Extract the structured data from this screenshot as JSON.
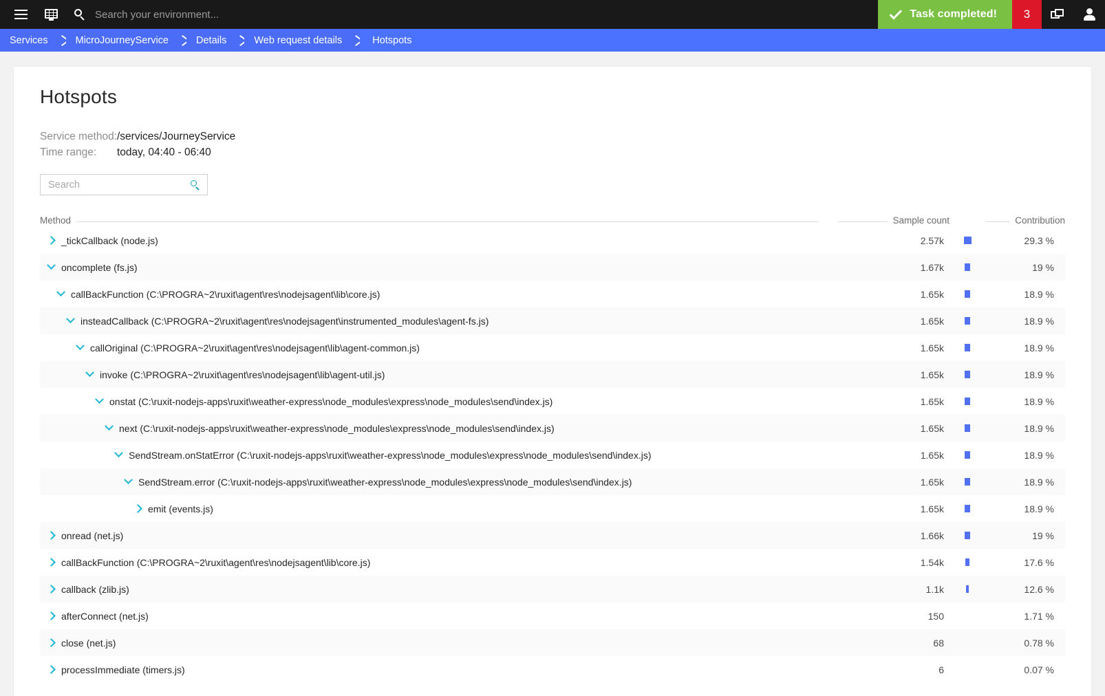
{
  "topbar": {
    "menu_icon": "hamburger-icon",
    "dashboard_icon": "dashboard-icon",
    "search_icon": "search-icon",
    "search_placeholder": "Search your environment...",
    "search_value": "",
    "task_banner_label": "Task completed!",
    "task_banner_color": "#7ac143",
    "notification_count": "3",
    "notification_color": "#dc172a",
    "windows_icon": "windows-icon",
    "user_icon": "user-icon"
  },
  "breadcrumb": {
    "accent": "#4a6cf7",
    "items": [
      {
        "label": "Services"
      },
      {
        "label": "MicroJourneyService"
      },
      {
        "label": "Details"
      },
      {
        "label": "Web request details"
      },
      {
        "label": "Hotspots"
      }
    ]
  },
  "page": {
    "title": "Hotspots",
    "service_method_label": "Service method:",
    "service_method_value": "/services/JourneyService",
    "time_range_label": "Time range:",
    "time_range_value": "today, 04:40 - 06:40"
  },
  "filter": {
    "placeholder": "Search",
    "value": "",
    "icon": "search-icon"
  },
  "table": {
    "columns": {
      "method": "Method",
      "sample_count": "Sample count",
      "contribution": "Contribution"
    },
    "bar_color": "#5271f2",
    "rows": [
      {
        "method": "_tickCallback (node.js)",
        "depth": 0,
        "expanded": false,
        "sample_count": "2.57k",
        "contribution": "29.3 %",
        "contribution_pct": 29.3
      },
      {
        "method": "oncomplete (fs.js)",
        "depth": 0,
        "expanded": true,
        "sample_count": "1.67k",
        "contribution": "19 %",
        "contribution_pct": 19
      },
      {
        "method": "callBackFunction (C:\\PROGRA~2\\ruxit\\agent\\res\\nodejsagent\\lib\\core.js)",
        "depth": 1,
        "expanded": true,
        "sample_count": "1.65k",
        "contribution": "18.9 %",
        "contribution_pct": 18.9
      },
      {
        "method": "insteadCallback (C:\\PROGRA~2\\ruxit\\agent\\res\\nodejsagent\\instrumented_modules\\agent-fs.js)",
        "depth": 2,
        "expanded": true,
        "sample_count": "1.65k",
        "contribution": "18.9 %",
        "contribution_pct": 18.9
      },
      {
        "method": "callOriginal (C:\\PROGRA~2\\ruxit\\agent\\res\\nodejsagent\\lib\\agent-common.js)",
        "depth": 3,
        "expanded": true,
        "sample_count": "1.65k",
        "contribution": "18.9 %",
        "contribution_pct": 18.9
      },
      {
        "method": "invoke (C:\\PROGRA~2\\ruxit\\agent\\res\\nodejsagent\\lib\\agent-util.js)",
        "depth": 4,
        "expanded": true,
        "sample_count": "1.65k",
        "contribution": "18.9 %",
        "contribution_pct": 18.9
      },
      {
        "method": "onstat (C:\\ruxit-nodejs-apps\\ruxit\\weather-express\\node_modules\\express\\node_modules\\send\\index.js)",
        "depth": 5,
        "expanded": true,
        "sample_count": "1.65k",
        "contribution": "18.9 %",
        "contribution_pct": 18.9
      },
      {
        "method": "next (C:\\ruxit-nodejs-apps\\ruxit\\weather-express\\node_modules\\express\\node_modules\\send\\index.js)",
        "depth": 6,
        "expanded": true,
        "sample_count": "1.65k",
        "contribution": "18.9 %",
        "contribution_pct": 18.9
      },
      {
        "method": "SendStream.onStatError (C:\\ruxit-nodejs-apps\\ruxit\\weather-express\\node_modules\\express\\node_modules\\send\\index.js)",
        "depth": 7,
        "expanded": true,
        "sample_count": "1.65k",
        "contribution": "18.9 %",
        "contribution_pct": 18.9
      },
      {
        "method": "SendStream.error (C:\\ruxit-nodejs-apps\\ruxit\\weather-express\\node_modules\\express\\node_modules\\send\\index.js)",
        "depth": 8,
        "expanded": true,
        "sample_count": "1.65k",
        "contribution": "18.9 %",
        "contribution_pct": 18.9
      },
      {
        "method": "emit (events.js)",
        "depth": 9,
        "expanded": false,
        "sample_count": "1.65k",
        "contribution": "18.9 %",
        "contribution_pct": 18.9
      },
      {
        "method": "onread (net.js)",
        "depth": 0,
        "expanded": false,
        "sample_count": "1.66k",
        "contribution": "19 %",
        "contribution_pct": 19
      },
      {
        "method": "callBackFunction (C:\\PROGRA~2\\ruxit\\agent\\res\\nodejsagent\\lib\\core.js)",
        "depth": 0,
        "expanded": false,
        "sample_count": "1.54k",
        "contribution": "17.6 %",
        "contribution_pct": 17.6
      },
      {
        "method": "callback (zlib.js)",
        "depth": 0,
        "expanded": false,
        "sample_count": "1.1k",
        "contribution": "12.6 %",
        "contribution_pct": 12.6
      },
      {
        "method": "afterConnect (net.js)",
        "depth": 0,
        "expanded": false,
        "sample_count": "150",
        "contribution": "1.71 %",
        "contribution_pct": 1.71
      },
      {
        "method": "close (net.js)",
        "depth": 0,
        "expanded": false,
        "sample_count": "68",
        "contribution": "0.78 %",
        "contribution_pct": 0.78
      },
      {
        "method": "processImmediate (timers.js)",
        "depth": 0,
        "expanded": false,
        "sample_count": "6",
        "contribution": "0.07 %",
        "contribution_pct": 0.07
      }
    ]
  }
}
